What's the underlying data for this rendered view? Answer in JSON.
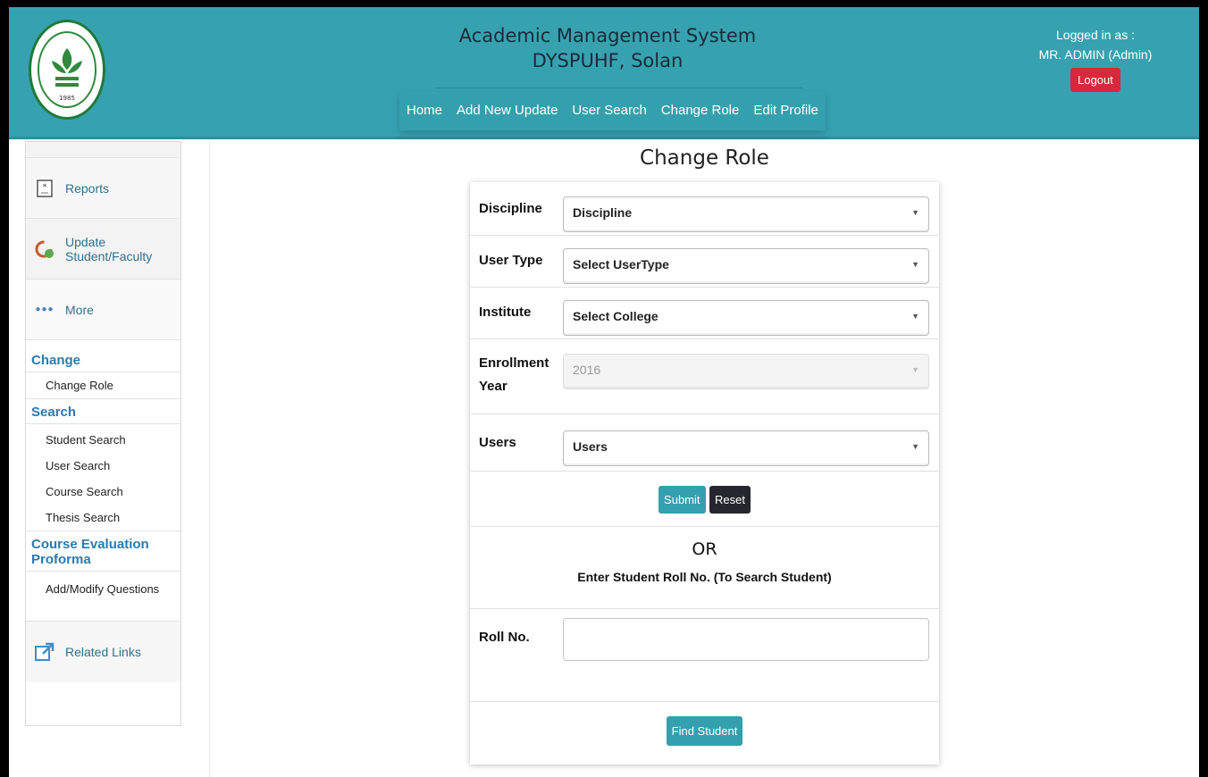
{
  "header": {
    "title_line1": "Academic Management System",
    "title_line2": "DYSPUHF, Solan",
    "nav": [
      "Home",
      "Add New Update",
      "User Search",
      "Change Role",
      "Edit Profile"
    ],
    "logged_in_label": "Logged in as :",
    "user_name": "MR. ADMIN (Admin)",
    "logout_label": "Logout",
    "logo_year": "1985"
  },
  "sidebar": {
    "blocks": [
      {
        "label": "Reports",
        "icon": "report-icon"
      },
      {
        "label": "Update Student/Faculty",
        "icon": "refresh-icon"
      },
      {
        "label": "More",
        "icon": "more-icon"
      }
    ],
    "sections": [
      {
        "title": "Change",
        "items": [
          "Change Role"
        ]
      },
      {
        "title": "Search",
        "items": [
          "Student Search",
          "User Search",
          "Course Search",
          "Thesis Search"
        ]
      },
      {
        "title": "Course Evaluation Proforma",
        "items": [
          "Add/Modify Questions"
        ]
      }
    ],
    "related_links": {
      "label": "Related Links",
      "icon": "external-link-icon"
    }
  },
  "main": {
    "heading": "Change Role",
    "fields": [
      {
        "label": "Discipline",
        "value": "Discipline"
      },
      {
        "label": "User Type",
        "value": "Select UserType"
      },
      {
        "label": "Institute",
        "value": "Select College"
      },
      {
        "label": "Enrollment Year",
        "value": "2016",
        "disabled": true
      },
      {
        "label": "Users",
        "value": "Users"
      }
    ],
    "submit_label": "Submit",
    "reset_label": "Reset",
    "or_label": "OR",
    "search_hint": "Enter Student Roll No. (To Search Student)",
    "roll_label": "Roll No.",
    "roll_value": "",
    "find_label": "Find Student"
  },
  "colors": {
    "header": "#36a2b0",
    "logout": "#d9283c",
    "accent_link": "#2a7ab0"
  }
}
